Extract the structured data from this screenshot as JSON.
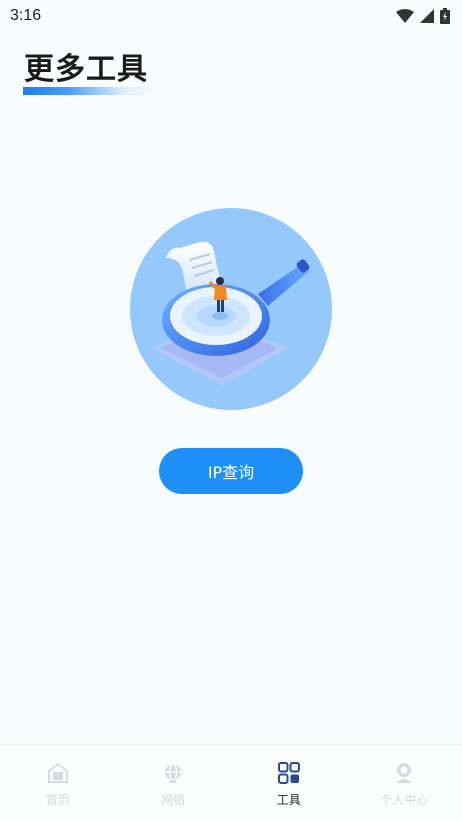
{
  "status_bar": {
    "time": "3:16",
    "icons": [
      "wifi-icon",
      "signal-icon",
      "battery-charging-icon"
    ]
  },
  "header": {
    "title": "更多工具"
  },
  "main": {
    "illustration": "magnifier-search-illustration",
    "ip_button_label": "IP查询"
  },
  "bottom_nav": {
    "items": [
      {
        "label": "首页",
        "icon": "home-icon",
        "active": false
      },
      {
        "label": "网络",
        "icon": "globe-icon",
        "active": false
      },
      {
        "label": "工具",
        "icon": "grid-tools-icon",
        "active": true
      },
      {
        "label": "个人中心",
        "icon": "user-icon",
        "active": false
      }
    ]
  },
  "colors": {
    "accent": "#1e8ff7",
    "background": "#f8fcfd",
    "inactive_nav": "#d3d7db",
    "active_nav_icon": "#2a4a8a"
  }
}
